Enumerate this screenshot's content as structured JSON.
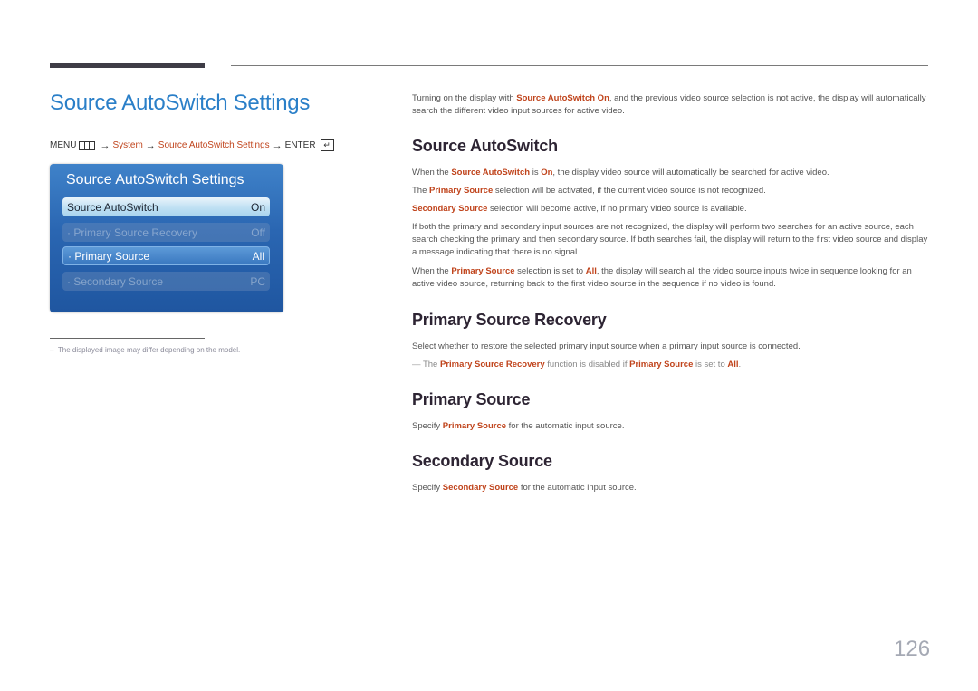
{
  "page_title": "Source AutoSwitch Settings",
  "menu_path": {
    "menu": "MENU",
    "menu_icon": "menu-grid-icon",
    "arrow": "→",
    "system": "System",
    "settings": "Source AutoSwitch Settings",
    "enter": "ENTER",
    "enter_icon": "enter-icon"
  },
  "osd": {
    "title": "Source AutoSwitch Settings",
    "rows": [
      {
        "label": "Source AutoSwitch",
        "value": "On",
        "state": "active"
      },
      {
        "label": "· Primary Source Recovery",
        "value": "Off",
        "state": "disabled"
      },
      {
        "label": "· Primary Source",
        "value": "All",
        "state": "enabled"
      },
      {
        "label": "· Secondary Source",
        "value": "PC",
        "state": "disabled"
      }
    ]
  },
  "footnote": "The displayed image may differ depending on the model.",
  "intro": {
    "t1": "Turning on the display with ",
    "h1": "Source AutoSwitch On",
    "t2": ", and the previous video source selection is not active, the display will automatically search the different video input sources for active video."
  },
  "sections": {
    "autoswitch": {
      "heading": "Source AutoSwitch",
      "p1": {
        "t1": "When the ",
        "h1": "Source AutoSwitch",
        "t2": " is ",
        "h2": "On",
        "t3": ", the display video source will automatically be searched for active video."
      },
      "p2": {
        "t1": "The ",
        "h1": "Primary Source",
        "t2": " selection will be activated, if the current video source is not recognized."
      },
      "p3": {
        "h1": "Secondary Source",
        "t1": " selection will become active, if no primary video source is available."
      },
      "p4": "If both the primary and secondary input sources are not recognized, the display will perform two searches for an active source, each search checking the primary and then secondary source. If both searches fail, the display will return to the first video source and display a message indicating that there is no signal.",
      "p5": {
        "t1": "When the ",
        "h1": "Primary Source",
        "t2": " selection is set to ",
        "h2": "All",
        "t3": ", the display will search all the video source inputs twice in sequence looking for an active video source, returning back to the first video source in the sequence if no video is found."
      }
    },
    "recovery": {
      "heading": "Primary Source Recovery",
      "p1": "Select whether to restore the selected primary input source when a primary input source is connected.",
      "note": {
        "dash": "—",
        "t1": " The ",
        "h1": "Primary Source Recovery",
        "t2": " function is disabled if ",
        "h2": "Primary Source",
        "t3": " is set to ",
        "h3": "All",
        "t4": "."
      }
    },
    "primary": {
      "heading": "Primary Source",
      "p1": {
        "t1": "Specify ",
        "h1": "Primary Source",
        "t2": " for the automatic input source."
      }
    },
    "secondary": {
      "heading": "Secondary Source",
      "p1": {
        "t1": "Specify ",
        "h1": "Secondary Source",
        "t2": " for the automatic input source."
      }
    }
  },
  "page_number": "126"
}
